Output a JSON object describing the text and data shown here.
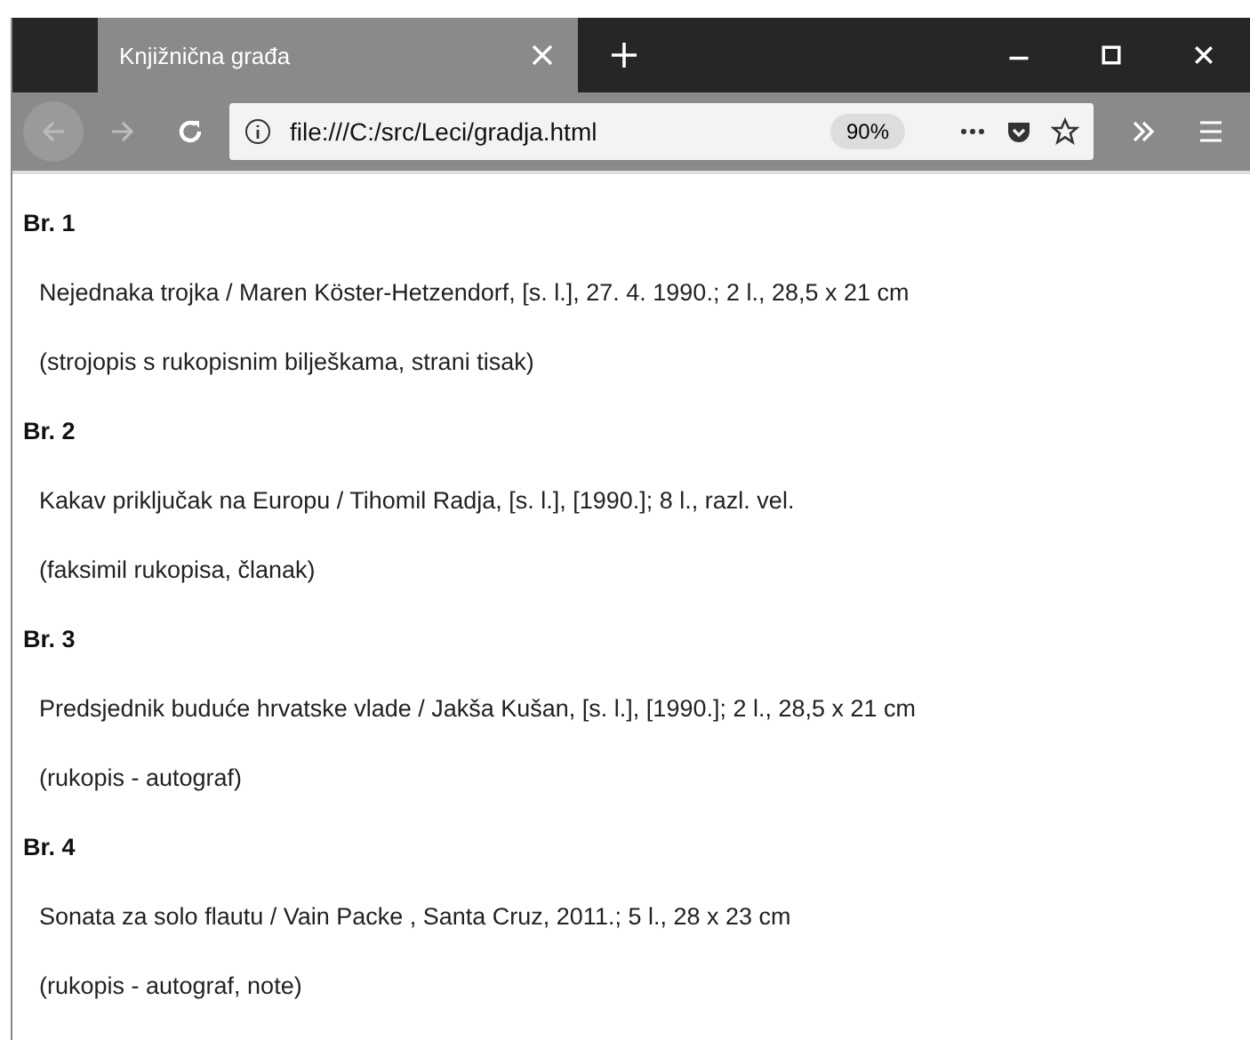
{
  "tab": {
    "title": "Knjižnična građa",
    "selected": true
  },
  "address_bar": {
    "url": "file:///C:/src/Leci/gradja.html",
    "zoom": "90%"
  },
  "entries": [
    {
      "heading": "Br. 1",
      "lines": [
        "Nejednaka trojka / Maren Köster-Hetzendorf, [s. l.], 27. 4. 1990.; 2 l., 28,5 x 21 cm",
        "(strojopis s rukopisnim bilješkama, strani tisak)"
      ]
    },
    {
      "heading": "Br. 2",
      "lines": [
        "Kakav priključak na Europu / Tihomil Radja, [s. l.], [1990.]; 8 l., razl. vel.",
        "(faksimil rukopisa, članak)"
      ]
    },
    {
      "heading": "Br. 3",
      "lines": [
        "Predsjednik buduće hrvatske vlade / Jakša Kušan, [s. l.], [1990.]; 2 l., 28,5 x 21 cm",
        "(rukopis - autograf)"
      ]
    },
    {
      "heading": "Br. 4",
      "lines": [
        "Sonata za solo flautu / Vain Packe , Santa Cruz, 2011.; 5 l., 28 x 23 cm",
        "(rukopis - autograf, note)"
      ]
    }
  ]
}
